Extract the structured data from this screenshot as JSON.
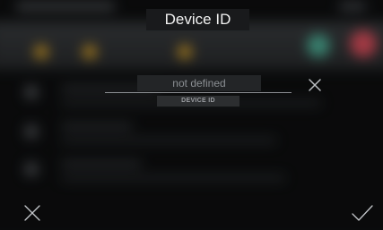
{
  "dialog": {
    "title": "Device ID",
    "field_value": "",
    "field_placeholder": "not defined",
    "field_caption": "DEVICE ID"
  },
  "actions": {
    "clear_icon": "close-icon",
    "cancel_icon": "close-icon",
    "confirm_icon": "checkmark-icon"
  },
  "colors": {
    "accent_orange": "#d9a32a",
    "accent_teal": "#4fb39a",
    "accent_red": "#e0505e"
  }
}
